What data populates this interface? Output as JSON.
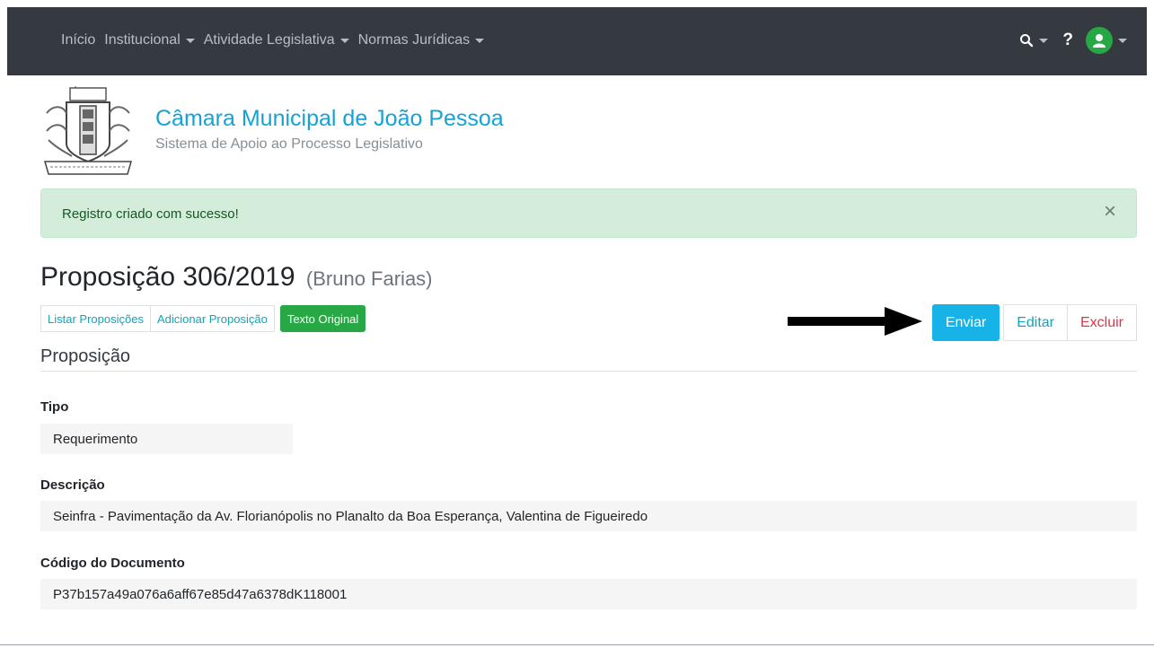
{
  "nav": {
    "items": [
      {
        "label": "Início",
        "has_caret": false
      },
      {
        "label": "Institucional",
        "has_caret": true
      },
      {
        "label": "Atividade Legislativa",
        "has_caret": true
      },
      {
        "label": "Normas Jurídicas",
        "has_caret": true
      }
    ],
    "help_label": "?",
    "icons": {
      "search": "search-icon",
      "user": "user-icon"
    }
  },
  "brand": {
    "title": "Câmara Municipal de João Pessoa",
    "subtitle": "Sistema de Apoio ao Processo Legislativo",
    "logo_motto": "INTREPIDA AB ORIGINE"
  },
  "alert": {
    "message": "Registro criado com sucesso!",
    "close_label": "×"
  },
  "page": {
    "title": "Proposição 306/2019",
    "author": "(Bruno Farias)"
  },
  "actions_left": {
    "list": "Listar Proposições",
    "add": "Adicionar Proposição",
    "original": "Texto Original"
  },
  "actions_right": {
    "send": "Enviar",
    "edit": "Editar",
    "delete": "Excluir"
  },
  "section": {
    "title": "Proposição"
  },
  "fields": {
    "tipo": {
      "label": "Tipo",
      "value": "Requerimento"
    },
    "descricao": {
      "label": "Descrição",
      "value": "Seinfra - Pavimentação da Av. Florianópolis no Planalto da Boa Esperança, Valentina de Figueiredo"
    },
    "codigo": {
      "label": "Código do Documento",
      "value": "P37b157a49a076a6aff67e85d47a6378dK118001"
    }
  },
  "colors": {
    "navbar": "#343a40",
    "brand": "#17a2d6",
    "success_bg": "#d4edda",
    "send_button": "#17b3e8",
    "original_button": "#28a745",
    "delete_text": "#dc3545"
  }
}
